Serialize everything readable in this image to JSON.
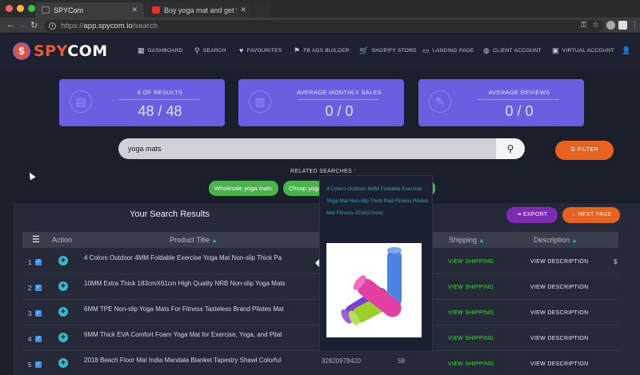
{
  "browser": {
    "tabs": [
      {
        "title": "SPYCom",
        "active": true
      },
      {
        "title": "Buy yoga mat and get free shi",
        "active": false
      }
    ],
    "url_prefix": "https://",
    "url_host": "app.spycom.io",
    "url_path": "/search"
  },
  "nav": {
    "logo_spy": "SPY",
    "logo_com": "COM",
    "items": [
      {
        "label": "DASHBOARD",
        "icon": "grid-icon"
      },
      {
        "label": "SEARCH",
        "icon": "search-icon"
      },
      {
        "label": "FAVOURITES",
        "icon": "heart-icon"
      },
      {
        "label": "FB ADS BUILDER",
        "icon": "flag-icon"
      },
      {
        "label": "SHOPIFY STORE",
        "icon": "cart-icon"
      },
      {
        "label": "LANDING PAGE",
        "icon": "laptop-icon"
      },
      {
        "label": "CLIENT ACCOUNT",
        "icon": "globe-icon"
      },
      {
        "label": "VIRTUAL ACCOUNT",
        "icon": "box-icon"
      }
    ]
  },
  "stats": [
    {
      "label": "# OF RESULTS",
      "value": "48 / 48"
    },
    {
      "label": "AVERAGE MONTHLY SALES",
      "value": "0 / 0"
    },
    {
      "label": "AVERAGE REVIEWS",
      "value": "0 / 0"
    }
  ],
  "search": {
    "query": "yoga mats",
    "filter_label": "FILTER"
  },
  "related": {
    "label": "RELATED SEARCHES :",
    "chips": [
      "Wholesale yoga mats",
      "Cheap yoga mats"
    ]
  },
  "results": {
    "title": "Your Search Results",
    "export_label": "EXPORT",
    "next_label": "NEXT PAGE",
    "columns": {
      "action": "Action",
      "product_title": "Product Title",
      "shipping": "Shipping",
      "description": "Description"
    },
    "rows": [
      {
        "num": "1",
        "title": "4 Colors Outdoor 4MM Foldable Exercise Yoga Mat Non-slip Thick Pa",
        "shipping": "VIEW SHIPPING",
        "description": "VIEW DESCRIPTION",
        "side": "$"
      },
      {
        "num": "2",
        "title": "10MM Extra Thick 183cmX61cm High Quality NRB Non-slip Yoga Mats",
        "shipping": "VIEW SHIPPING",
        "description": "VIEW DESCRIPTION",
        "side": ""
      },
      {
        "num": "3",
        "title": "6MM TPE Non-slip Yoga Mats For Fitness Tasteless Brand Pilates Mat",
        "shipping": "VIEW SHIPPING",
        "description": "VIEW DESCRIPTION",
        "side": ""
      },
      {
        "num": "4",
        "title": "6MM Thick EVA Comfort Foam Yoga Mat for Exercise, Yoga, and Pilat",
        "shipping": "VIEW SHIPPING",
        "description": "VIEW DESCRIPTION",
        "side": ""
      },
      {
        "num": "5",
        "title": "2018 Beach Floor Mat India Mandala Blanket Tapestry Shawl Colorful",
        "shipping": "VIEW SHIPPING",
        "description": "VIEW DESCRIPTION",
        "side": "",
        "extra1": "32820978420",
        "extra2": "58"
      }
    ]
  },
  "popover": {
    "text": "4 Colors Outdoor 4MM Foldable Exercise Yoga Mat Non-slip Thick Pad Fitness Pilates Mat Fitness 2018(China)"
  }
}
